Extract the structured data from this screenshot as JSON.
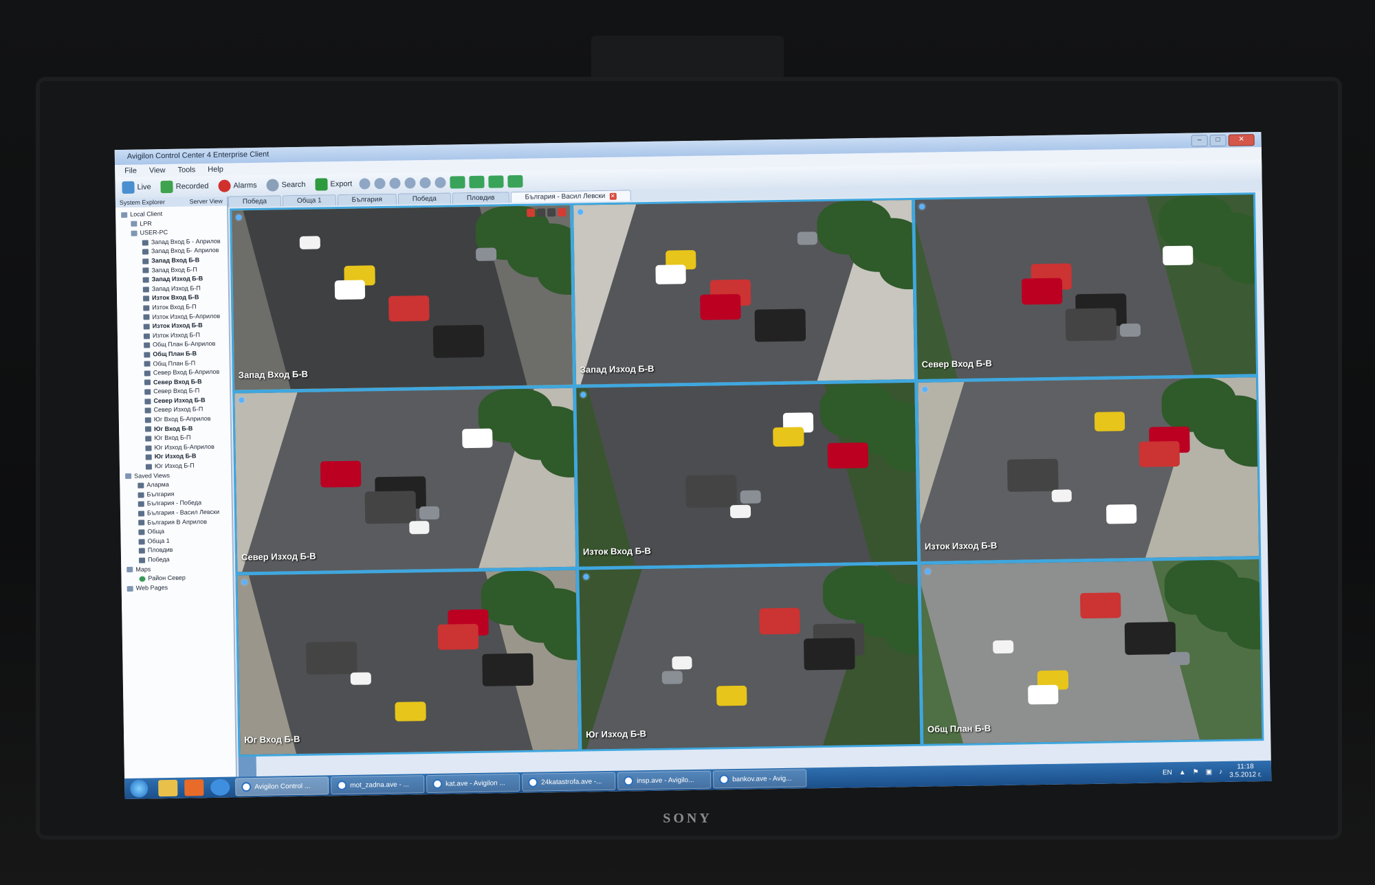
{
  "monitor": {
    "brand": "SONY"
  },
  "window": {
    "title": "Avigilon Control Center 4 Enterprise Client"
  },
  "menu": [
    "File",
    "View",
    "Tools",
    "Help"
  ],
  "toolbar": {
    "live": "Live",
    "recorded": "Recorded",
    "alarms": "Alarms",
    "search": "Search",
    "export": "Export"
  },
  "sidebar": {
    "tab_system": "System Explorer",
    "tab_server": "Server View",
    "tree": [
      {
        "label": "Local Client",
        "bold": false
      },
      {
        "label": "LPR",
        "bold": false
      },
      {
        "label": "USER-PC",
        "bold": false
      },
      {
        "label": "Запад Вход Б - Априлов",
        "bold": false
      },
      {
        "label": "Запад Вход Б- Априлов",
        "bold": false
      },
      {
        "label": "Запад Вход Б-В",
        "bold": true
      },
      {
        "label": "Запад Вход Б-П",
        "bold": false
      },
      {
        "label": "Запад Изход Б-В",
        "bold": true
      },
      {
        "label": "Запад Изход Б-П",
        "bold": false
      },
      {
        "label": "Изток Вход Б-В",
        "bold": true
      },
      {
        "label": "Изток Вход Б-П",
        "bold": false
      },
      {
        "label": "Изток Изход Б-Априлов",
        "bold": false
      },
      {
        "label": "Изток Изход Б-В",
        "bold": true
      },
      {
        "label": "Изток Изход Б-П",
        "bold": false
      },
      {
        "label": "Общ План Б-Априлов",
        "bold": false
      },
      {
        "label": "Общ План Б-В",
        "bold": true
      },
      {
        "label": "Общ План Б-П",
        "bold": false
      },
      {
        "label": "Север Вход Б-Априлов",
        "bold": false
      },
      {
        "label": "Север Вход Б-В",
        "bold": true
      },
      {
        "label": "Север Вход Б-П",
        "bold": false
      },
      {
        "label": "Север Изход Б-В",
        "bold": true
      },
      {
        "label": "Север Изход Б-П",
        "bold": false
      },
      {
        "label": "Юг Вход Б-Априлов",
        "bold": false
      },
      {
        "label": "Юг Вход Б-В",
        "bold": true
      },
      {
        "label": "Юг Вход Б-П",
        "bold": false
      },
      {
        "label": "Юг Изход Б-Априлов",
        "bold": false
      },
      {
        "label": "Юг Изход Б-В",
        "bold": true
      },
      {
        "label": "Юг Изход Б-П",
        "bold": false
      },
      {
        "label": "Saved Views",
        "bold": false
      },
      {
        "label": "Аларма",
        "bold": false
      },
      {
        "label": "България",
        "bold": false
      },
      {
        "label": "България - Победа",
        "bold": false
      },
      {
        "label": "България - Васил Левски",
        "bold": false
      },
      {
        "label": "България В Априлов",
        "bold": false
      },
      {
        "label": "Обща",
        "bold": false
      },
      {
        "label": "Обща 1",
        "bold": false
      },
      {
        "label": "Пловдив",
        "bold": false
      },
      {
        "label": "Победа",
        "bold": false
      },
      {
        "label": "Maps",
        "bold": false
      },
      {
        "label": "Район Север",
        "bold": false
      },
      {
        "label": "Web Pages",
        "bold": false
      }
    ]
  },
  "tabs": [
    "Победа",
    "Обща 1",
    "България",
    "Победа",
    "Пловдив",
    "България - Васил Левски"
  ],
  "cameras": [
    {
      "label": "Запад Вход Б-В"
    },
    {
      "label": "Запад Изход Б-В"
    },
    {
      "label": "Север Вход Б-В"
    },
    {
      "label": "Север Изход Б-В"
    },
    {
      "label": "Изток Вход Б-В"
    },
    {
      "label": "Изток Изход Б-В"
    },
    {
      "label": "Юг Вход Б-В"
    },
    {
      "label": "Юг Изход Б-В"
    },
    {
      "label": "Общ План Б-В"
    }
  ],
  "taskbar": {
    "tasks": [
      "Avigilon Control ...",
      "mot_zadna.ave - ...",
      "kat.ave - Avigilon ...",
      "24katastrofa.ave -...",
      "insp.ave - Avigilo...",
      "bankov.ave - Avig..."
    ],
    "lang": "EN",
    "time": "11:18",
    "date": "3.5.2012 г."
  }
}
